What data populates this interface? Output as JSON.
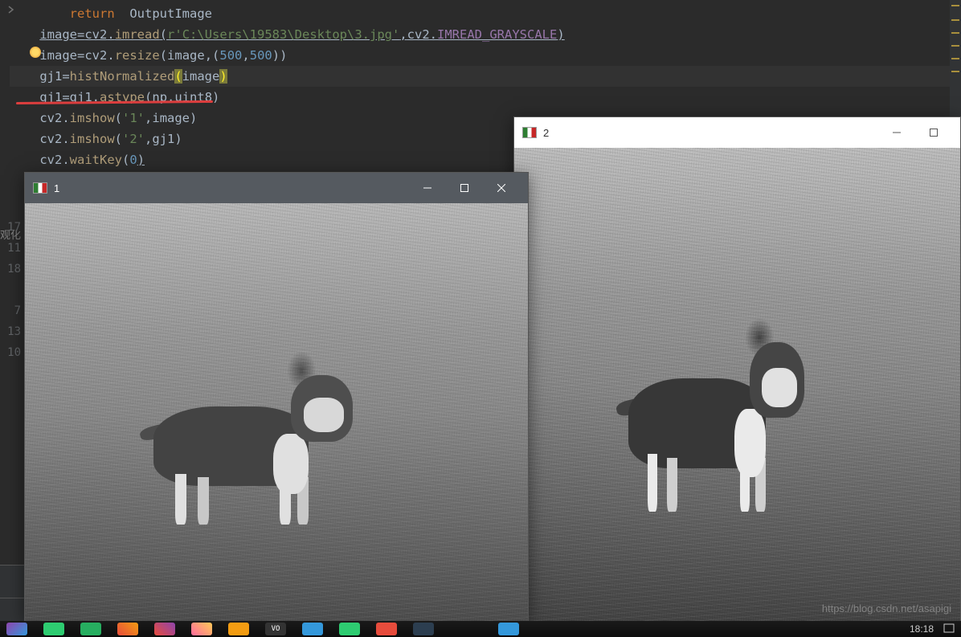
{
  "code": {
    "lines": [
      {
        "segments": [
          {
            "t": "        ",
            "c": ""
          },
          {
            "t": "return",
            "c": "kw"
          },
          {
            "t": "  ",
            "c": ""
          },
          {
            "t": "OutputImage",
            "c": "id"
          }
        ]
      },
      {
        "segments": [
          {
            "t": "    ",
            "c": ""
          },
          {
            "t": "image",
            "c": "id underline"
          },
          {
            "t": "=",
            "c": "op underline"
          },
          {
            "t": "cv2",
            "c": "id underline"
          },
          {
            "t": ".",
            "c": "op underline"
          },
          {
            "t": "imread",
            "c": "fn underline"
          },
          {
            "t": "(",
            "c": "op underline"
          },
          {
            "t": "r'C:\\Users\\19583\\Desktop\\3.jpg'",
            "c": "str underline"
          },
          {
            "t": ",",
            "c": "op underline"
          },
          {
            "t": "cv2",
            "c": "id underline"
          },
          {
            "t": ".",
            "c": "op underline"
          },
          {
            "t": "IMREAD_GRAYSCALE",
            "c": "param underline"
          },
          {
            "t": ")",
            "c": "op underline"
          }
        ]
      },
      {
        "segments": [
          {
            "t": "    ",
            "c": ""
          },
          {
            "t": "image",
            "c": "id"
          },
          {
            "t": "=",
            "c": "op"
          },
          {
            "t": "cv2",
            "c": "id"
          },
          {
            "t": ".",
            "c": "op"
          },
          {
            "t": "resize",
            "c": "fn"
          },
          {
            "t": "(",
            "c": "op"
          },
          {
            "t": "image",
            "c": "id"
          },
          {
            "t": ",",
            "c": "op"
          },
          {
            "t": "(",
            "c": "op"
          },
          {
            "t": "500",
            "c": "num"
          },
          {
            "t": ",",
            "c": "op"
          },
          {
            "t": "500",
            "c": "num"
          },
          {
            "t": "))",
            "c": "op"
          }
        ]
      },
      {
        "segments": [
          {
            "t": "    ",
            "c": ""
          },
          {
            "t": "gj1",
            "c": "id"
          },
          {
            "t": "=",
            "c": "op"
          },
          {
            "t": "histNormalized",
            "c": "fn"
          },
          {
            "t": "(",
            "c": "hl-paren"
          },
          {
            "t": "image",
            "c": "id"
          },
          {
            "t": ")",
            "c": "hl-paren"
          }
        ],
        "current": true
      },
      {
        "segments": [
          {
            "t": "    ",
            "c": ""
          },
          {
            "t": "gj1",
            "c": "id underline"
          },
          {
            "t": "=",
            "c": "op underline"
          },
          {
            "t": "gj1",
            "c": "id"
          },
          {
            "t": ".",
            "c": "op"
          },
          {
            "t": "astype",
            "c": "fn"
          },
          {
            "t": "(",
            "c": "op"
          },
          {
            "t": "np",
            "c": "id"
          },
          {
            "t": ".",
            "c": "op"
          },
          {
            "t": "uint8",
            "c": "id"
          },
          {
            "t": ")",
            "c": "op"
          }
        ]
      },
      {
        "segments": [
          {
            "t": "    ",
            "c": ""
          },
          {
            "t": "cv2",
            "c": "id"
          },
          {
            "t": ".",
            "c": "op"
          },
          {
            "t": "imshow",
            "c": "fn"
          },
          {
            "t": "(",
            "c": "op"
          },
          {
            "t": "'1'",
            "c": "str"
          },
          {
            "t": ",",
            "c": "op"
          },
          {
            "t": "image",
            "c": "id"
          },
          {
            "t": ")",
            "c": "op"
          }
        ]
      },
      {
        "segments": [
          {
            "t": "    ",
            "c": ""
          },
          {
            "t": "cv2",
            "c": "id"
          },
          {
            "t": ".",
            "c": "op"
          },
          {
            "t": "imshow",
            "c": "fn"
          },
          {
            "t": "(",
            "c": "op"
          },
          {
            "t": "'2'",
            "c": "str"
          },
          {
            "t": ",",
            "c": "op"
          },
          {
            "t": "gj1",
            "c": "id"
          },
          {
            "t": ")",
            "c": "op"
          }
        ]
      },
      {
        "segments": [
          {
            "t": "    ",
            "c": ""
          },
          {
            "t": "cv2",
            "c": "id"
          },
          {
            "t": ".",
            "c": "op"
          },
          {
            "t": "waitKey",
            "c": "fn"
          },
          {
            "t": "(",
            "c": "op"
          },
          {
            "t": "0",
            "c": "num"
          },
          {
            "t": ")",
            "c": "op underline"
          }
        ]
      }
    ]
  },
  "gutter_label": "观化",
  "gutter_numbers": [
    "17",
    "11",
    "18",
    "",
    "7",
    "13",
    "10"
  ],
  "window1": {
    "title": "1"
  },
  "window2": {
    "title": "2"
  },
  "watermark": "https://blog.csdn.net/asapigi",
  "taskbar": {
    "time": "18:18"
  }
}
